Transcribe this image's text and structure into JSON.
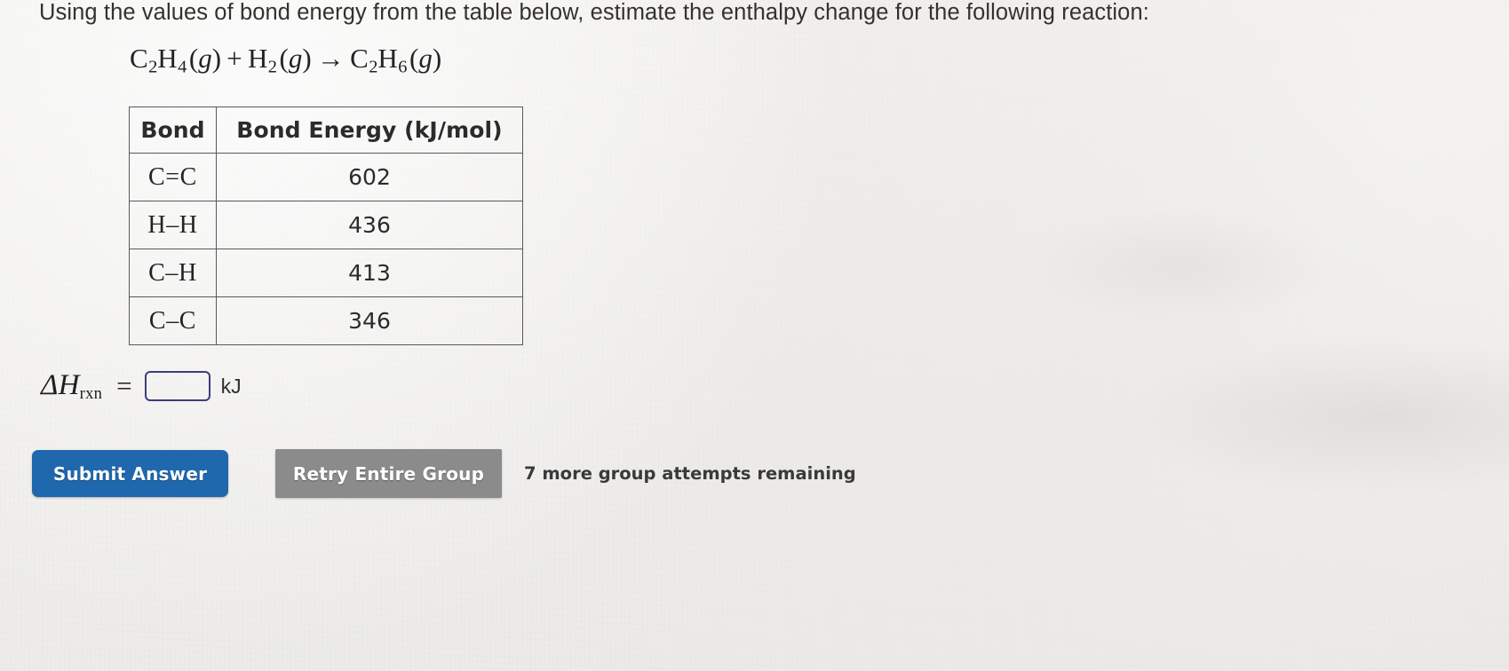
{
  "prompt": {
    "text": "Using the values of bond energy from the table below, estimate the enthalpy change for the following reaction:"
  },
  "equation": {
    "plain": "C2H4(g) + H2(g) → C2H6(g)",
    "reactant1": {
      "formula": "C2H4",
      "c_count": "2",
      "h_count": "4",
      "state": "g"
    },
    "reactant2": {
      "formula": "H2",
      "h_count": "2",
      "state": "g"
    },
    "product": {
      "formula": "C2H6",
      "c_count": "2",
      "h_count": "6",
      "state": "g"
    },
    "plus": "+",
    "arrow": "→"
  },
  "table": {
    "headers": [
      "Bond",
      "Bond Energy (kJ/mol)"
    ],
    "rows": [
      {
        "bond": "C=C",
        "energy": "602"
      },
      {
        "bond": "H–H",
        "energy": "436"
      },
      {
        "bond": "C–H",
        "energy": "413"
      },
      {
        "bond": "C–C",
        "energy": "346"
      }
    ]
  },
  "answer": {
    "label_delta": "Δ",
    "label_h": "H",
    "label_subscript": "rxn",
    "equals": "=",
    "value": "",
    "placeholder": "",
    "unit": "kJ",
    "border_color": "#3b3f78"
  },
  "actions": {
    "submit_label": "Submit Answer",
    "retry_label": "Retry Entire Group",
    "attempts_text": "7 more group attempts remaining",
    "submit_color": "#1f68ad",
    "retry_color": "#8b8b8b"
  },
  "colors": {
    "background": "#f1f0ee",
    "text": "#2b2b2b",
    "table_border": "#58595a"
  }
}
